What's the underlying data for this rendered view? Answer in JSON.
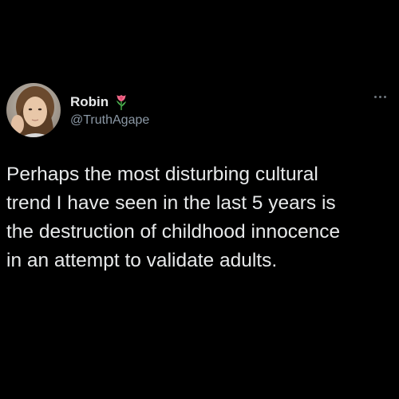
{
  "user": {
    "display_name": "Robin",
    "handle": "@TruthAgape",
    "badge_icon": "rose-emoji-icon"
  },
  "tweet": {
    "lines": [
      "Perhaps the most disturbing cultural",
      "trend I have seen in the last 5 years is",
      "the destruction of childhood innocence",
      "in an attempt to validate adults."
    ]
  },
  "colors": {
    "background": "#000000",
    "text": "#e7e9ea",
    "secondary": "#8b98a5"
  }
}
